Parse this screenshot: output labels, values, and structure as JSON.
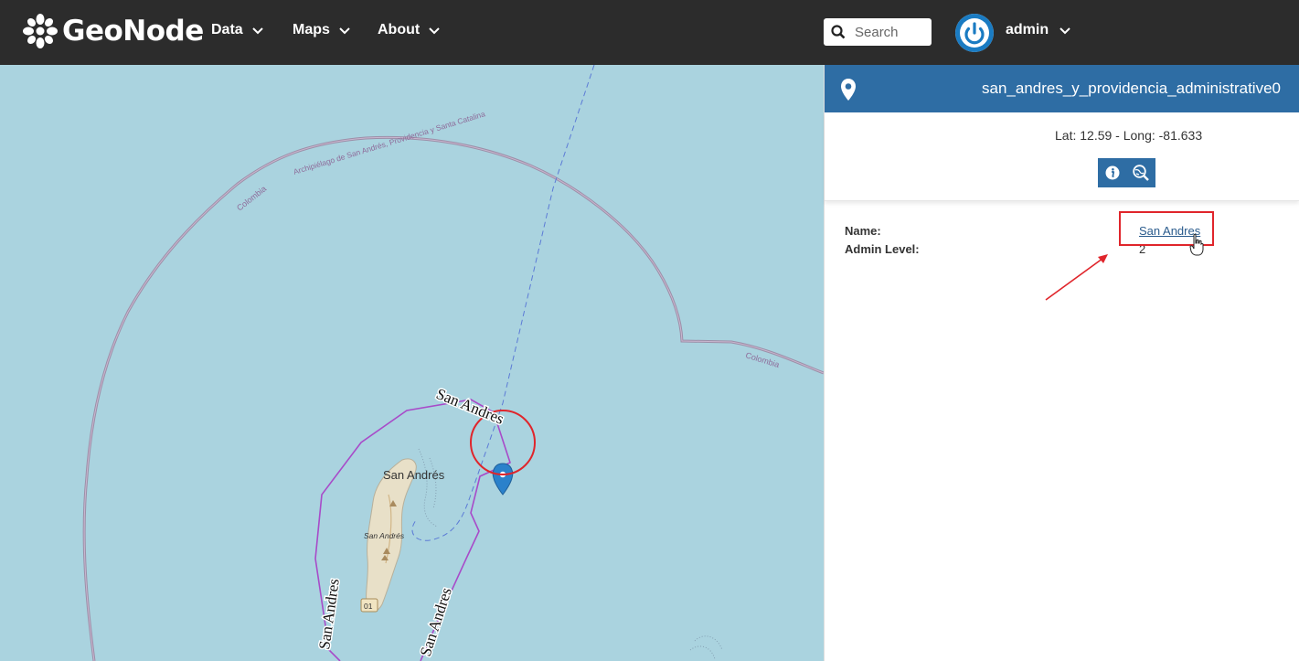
{
  "app": {
    "brand": "GeoNode",
    "nav": [
      {
        "label": "Data",
        "icon": "chevron-down-icon"
      },
      {
        "label": "Maps",
        "icon": "chevron-down-icon"
      },
      {
        "label": "About",
        "icon": "chevron-down-icon"
      }
    ],
    "search_placeholder": "Search",
    "user": "admin"
  },
  "map": {
    "labels": {
      "colombia_1": "Colombia",
      "colombia_2": "Colombia",
      "archipelago": "Archipiélago de San Andrés, Providencia y Santa Catalina",
      "island_name": "San Andrés",
      "island_small": "San Andrés",
      "road_shield": "01",
      "boundary_top": "San Andres",
      "boundary_left": "San Andres",
      "boundary_right": "San Andres"
    },
    "colors": {
      "water": "#aad3df",
      "land": "#f2efe9",
      "boundary": "#a84bc9",
      "marker": "#2a81cb"
    }
  },
  "panel": {
    "layer_title": "san_andres_y_providencia_administrative0",
    "coordinates": "Lat: 12.59 - Long: -81.633",
    "tools": [
      {
        "icon": "info-icon"
      },
      {
        "icon": "zoom-to-feature-icon"
      }
    ],
    "attributes": [
      {
        "label": "Name:",
        "value": "San Andres",
        "is_link": true
      },
      {
        "label": "Admin Level:",
        "value": "2",
        "is_link": false
      }
    ]
  },
  "colors": {
    "navbar": "#2c2c2c",
    "panel_header": "#2e6da4",
    "annotation": "#e0252b"
  }
}
